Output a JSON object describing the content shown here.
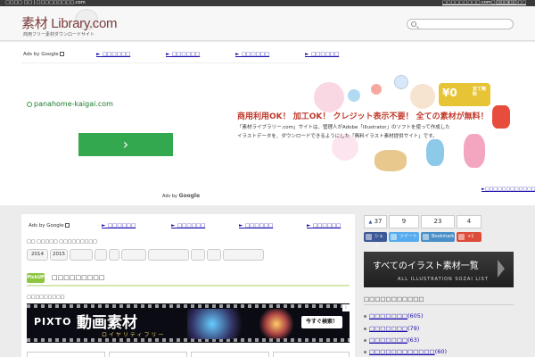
{
  "topbar": {
    "left_text": "□□□□ □□ | □□□□□□□□□.com",
    "right_link_1": "□□□□□□□□□.com□□□□□□",
    "right_link_2": "□□□□□□□"
  },
  "header": {
    "logo_text": "素材 Library.com",
    "tagline": "商用フリー素材ダウンロードサイト",
    "search_placeholder": ""
  },
  "ad_top": {
    "ads_by": "Ads by Google",
    "links": [
      "►_□□□□□□",
      "►_□□□□□□",
      "►_□□□□□□",
      "►_□□□□□□"
    ],
    "url": "panahome-kaigai.com",
    "button_glyph": "›",
    "footer_prefix": "Ads by",
    "footer_brand": "Google"
  },
  "hero": {
    "price": "¥0",
    "price_note": "全て無料",
    "title": "商用利用OK！ 加工OK！ クレジット表示不要！ 全ての素材が無料！",
    "desc_line_1": "「素材ライブラリー.com」サイトは、管理人がAdobe「Illustrator」のソフトを使って作成した",
    "desc_line_2": "イラストデータを、ダウンロードできるようにした「無料イラスト素材提供サイト」です。",
    "link": "►□□□□□□□□□□□□"
  },
  "main": {
    "ads_by": "Ads by Google",
    "links": [
      "►_□□□□□□",
      "►_□□□□□□",
      "►_□□□□□□",
      "►_□□□□□□"
    ],
    "tag_line": "□□ □□□□□ □□□□□□□□□",
    "pills": [
      "2014",
      "2015",
      "",
      "",
      "",
      "",
      "",
      "",
      "",
      ""
    ],
    "pickup_badge": "PickUP",
    "pickup_title": "□□□□□□□□□",
    "small_label": "□□□□□□□□□",
    "pixto": {
      "logo": "PIXTO",
      "headline": "動画素材",
      "subline": "ロイヤリティフリー",
      "button": "今すぐ検索！"
    },
    "ad_mark": "i"
  },
  "social": {
    "like_count": "37",
    "count_2": "9",
    "count_3": "23",
    "count_4": "4",
    "share_label": "シェア",
    "tweet_label": "ツイート",
    "bookmark_label": "Bookmark",
    "gplus_label": "+1"
  },
  "sidebar": {
    "banner_title": "すべてのイラスト素材一覧",
    "banner_sub": "ALL ILLUSTRATION SOZAI LIST",
    "section_title": "□□□□□□□□□□□",
    "items": [
      {
        "label": "□□□□□□□",
        "count": "(605)"
      },
      {
        "label": "□□□□□□□",
        "count": "(79)"
      },
      {
        "label": "□□□□□□□",
        "count": "(63)"
      },
      {
        "label": "□□□□□□□□□□□□",
        "count": "(60)"
      }
    ]
  },
  "colors": {
    "ad_button": "#34a84f",
    "pickup": "#8cc63f",
    "title_red": "#c0392b",
    "price_yellow": "#e7c436"
  }
}
